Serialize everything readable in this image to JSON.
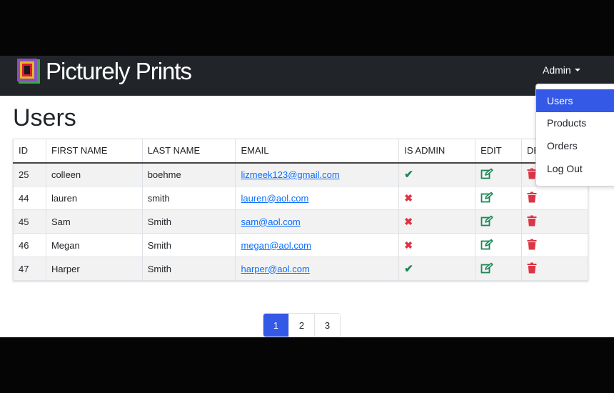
{
  "brand": {
    "name": "Picturely Prints"
  },
  "nav": {
    "admin_label": "Admin"
  },
  "dropdown": {
    "items": [
      {
        "label": "Users",
        "active": true
      },
      {
        "label": "Products",
        "active": false
      },
      {
        "label": "Orders",
        "active": false
      },
      {
        "label": "Log Out",
        "active": false
      }
    ]
  },
  "page": {
    "title": "Users"
  },
  "table": {
    "headers": [
      "ID",
      "FIRST NAME",
      "LAST NAME",
      "EMAIL",
      "IS ADMIN",
      "EDIT",
      "DELETE"
    ],
    "rows": [
      {
        "id": "25",
        "first": "colleen",
        "last": "boehme",
        "email": "lizmeek123@gmail.com",
        "is_admin": true
      },
      {
        "id": "44",
        "first": "lauren",
        "last": "smith",
        "email": "lauren@aol.com",
        "is_admin": false
      },
      {
        "id": "45",
        "first": "Sam",
        "last": "Smith",
        "email": "sam@aol.com",
        "is_admin": false
      },
      {
        "id": "46",
        "first": "Megan",
        "last": "Smith",
        "email": "megan@aol.com",
        "is_admin": false
      },
      {
        "id": "47",
        "first": "Harper",
        "last": "Smith",
        "email": "harper@aol.com",
        "is_admin": true
      }
    ]
  },
  "pagination": {
    "pages": [
      "1",
      "2",
      "3"
    ],
    "current": "1"
  },
  "colors": {
    "accent": "#3459e6",
    "navbar": "#212529",
    "check": "#198754",
    "cross": "#dc3545"
  }
}
